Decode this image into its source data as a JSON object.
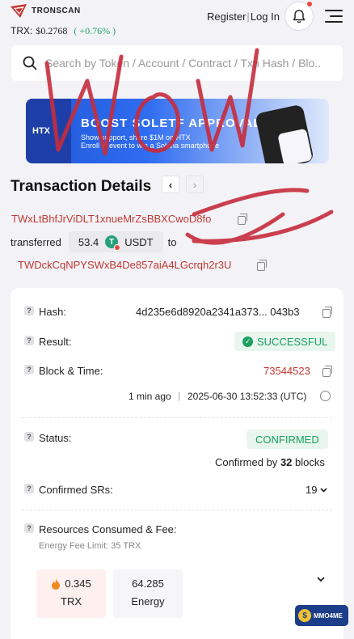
{
  "header": {
    "logo_text": "TRONSCAN",
    "trx_label": "TRX:",
    "trx_price": "$0.2768",
    "trx_change": "( +0.76% )",
    "register": "Register",
    "separator": "|",
    "login": "Log In"
  },
  "search": {
    "placeholder": "Search by Token / Account / Contract / Txn Hash / Blo..."
  },
  "banner": {
    "brand": "HTX",
    "title": "BOOST SOLETF APPROVAL",
    "line1": "Show support, share $1M on HTX",
    "line2": "Enroll in event to win a Solana smartphone"
  },
  "page": {
    "title": "Transaction Details"
  },
  "transfer": {
    "from": "TWxLtBhfJrViDLT1xnueMrZsBBXCwoD8fo",
    "word_transferred": "transferred",
    "amount": "53.4",
    "token": "USDT",
    "word_to": "to",
    "to": "TWDckCqNPYSWxB4De857aiA4LGcrqh2r3U"
  },
  "details": {
    "hash_label": "Hash:",
    "hash_value": "4d235e6d8920a2341a373... 043b3",
    "result_label": "Result:",
    "result_value": "SUCCESSFUL",
    "block_label": "Block & Time:",
    "block_value": "73544523",
    "time_ago": "1 min ago",
    "time_sep": "|",
    "timestamp": "2025-06-30 13:52:33 (UTC)",
    "status_label": "Status:",
    "status_value": "CONFIRMED",
    "confirmed_by_prefix": "Confirmed by",
    "confirmed_by_count": "32",
    "confirmed_by_suffix": "blocks",
    "srs_label": "Confirmed SRs:",
    "srs_value": "19",
    "resources_label": "Resources Consumed & Fee:",
    "energy_fee_limit": "Energy Fee Limit: 35 TRX",
    "trx_amount": "0.345",
    "trx_unit": "TRX",
    "energy_amount": "64.285",
    "energy_unit": "Energy"
  },
  "watermark": {
    "text": "MMO4ME"
  },
  "colors": {
    "accent_red": "#c23631",
    "success_green": "#1aa060",
    "trx_change_green": "#1fa36a",
    "scribble": "#c62c3c"
  }
}
